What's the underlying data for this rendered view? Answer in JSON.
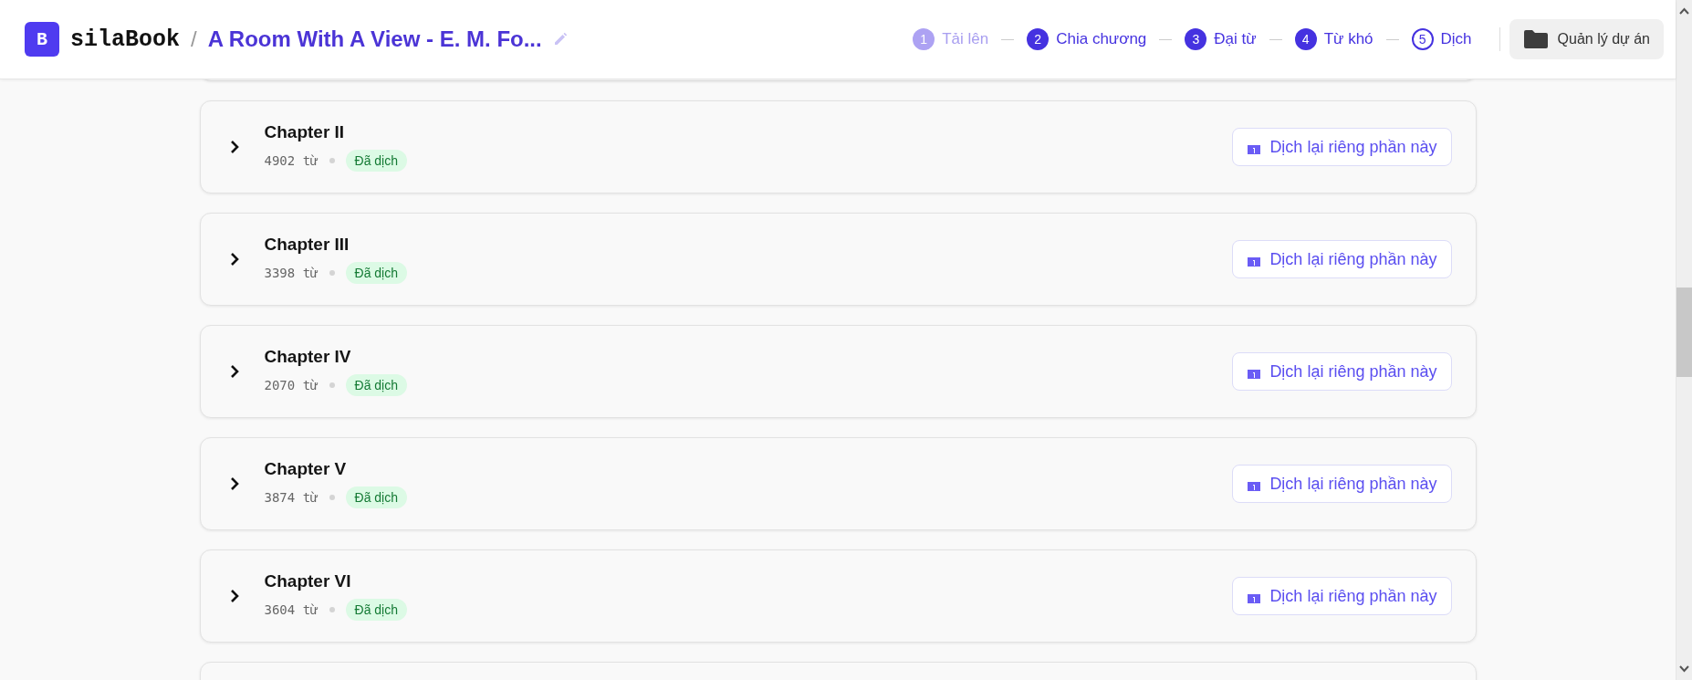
{
  "header": {
    "logo_letter": "B",
    "brand": "silaBook",
    "separator": "/",
    "project_title": "A Room With A View - E. M. Fo...",
    "steps": [
      {
        "number": "1",
        "label": "Tải lên",
        "disabled": true,
        "selected": false
      },
      {
        "number": "2",
        "label": "Chia chương",
        "disabled": false,
        "selected": false
      },
      {
        "number": "3",
        "label": "Đại từ",
        "disabled": false,
        "selected": false
      },
      {
        "number": "4",
        "label": "Từ khó",
        "disabled": false,
        "selected": false
      },
      {
        "number": "5",
        "label": "Dịch",
        "disabled": false,
        "selected": true
      }
    ],
    "manage_button": "Quản lý dự án"
  },
  "chapters": [
    {
      "title": "Chapter II",
      "word_count": "4902 từ",
      "status": "Đã dịch",
      "action": "Dịch lại riêng phần này"
    },
    {
      "title": "Chapter III",
      "word_count": "3398 từ",
      "status": "Đã dịch",
      "action": "Dịch lại riêng phần này"
    },
    {
      "title": "Chapter IV",
      "word_count": "2070 từ",
      "status": "Đã dịch",
      "action": "Dịch lại riêng phần này"
    },
    {
      "title": "Chapter V",
      "word_count": "3874 từ",
      "status": "Đã dịch",
      "action": "Dịch lại riêng phần này"
    },
    {
      "title": "Chapter VI",
      "word_count": "3604 từ",
      "status": "Đã dịch",
      "action": "Dịch lại riêng phần này"
    }
  ]
}
